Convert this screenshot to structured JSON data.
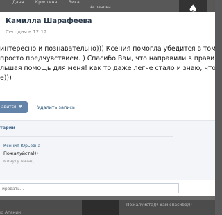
{
  "background": {
    "friend_names": [
      "Даня",
      "Кристина",
      "Вика"
    ],
    "friend_names_line2": [
      "",
      "",
      "Асланова"
    ],
    "tile_symbol": "♠",
    "bottom_text": "Пожалуйста))) Вам спасибо)))",
    "bottom_left_text": "ю Апакин"
  },
  "post": {
    "author": "Камилла Шарафеева",
    "time": "Сегодня в 12:12",
    "lines": [
      "интересно и познавательно))) Ксения помогла убедится в том, что я",
      "просто предчувствием. ) Спасибо Вам, что направили в правильное р",
      "льшая помощь для меня! как то даже легче стало и знаю, что делат",
      "е)))"
    ]
  },
  "actions": {
    "like_label": "авится",
    "heart": "♥",
    "delete_label": "Удалить запись"
  },
  "comments": {
    "title": "тарий",
    "items": [
      {
        "author": "Ксения Юрьевна",
        "text": "Пожалуйста)))",
        "time": "минуту назад"
      }
    ],
    "reply_placeholder": "ировать..."
  },
  "colors": {
    "accent_button": "#6383a8",
    "link": "#2b587a",
    "author": "#2b3a4b",
    "overlay": "#6a6a6a"
  }
}
